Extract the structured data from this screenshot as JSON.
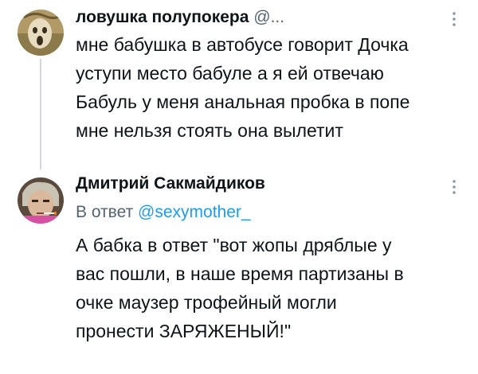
{
  "tweets": [
    {
      "author_name": "ловушка полупокера",
      "handle_trunc": "@...",
      "lines": [
        "мне бабушка в автобусе говорит Дочка",
        "уступи место бабуле а я ей отвечаю",
        "Бабуль у меня анальная пробка в попе",
        "мне нельзя стоять она вылетит"
      ]
    },
    {
      "author_name": "Дмитрий Сакмайдиков",
      "reply_prefix": "В ответ",
      "reply_handle": "@sexymother_",
      "lines": [
        "А бабка в ответ \"вот жопы дряблые у",
        "вас пошли, в наше время партизаны в",
        "очке маузер трофейный могли",
        "пронести ЗАРЯЖЕНЫЙ!\""
      ]
    }
  ],
  "icons": {
    "more": "more-vertical-icon",
    "avatar1": "avatar-screaming-figure",
    "avatar2": "avatar-man-with-cigarette"
  },
  "colors": {
    "text": "#0f1419",
    "secondary": "#536471",
    "link": "#1d9bf0",
    "thread_line": "#cfd9de"
  }
}
